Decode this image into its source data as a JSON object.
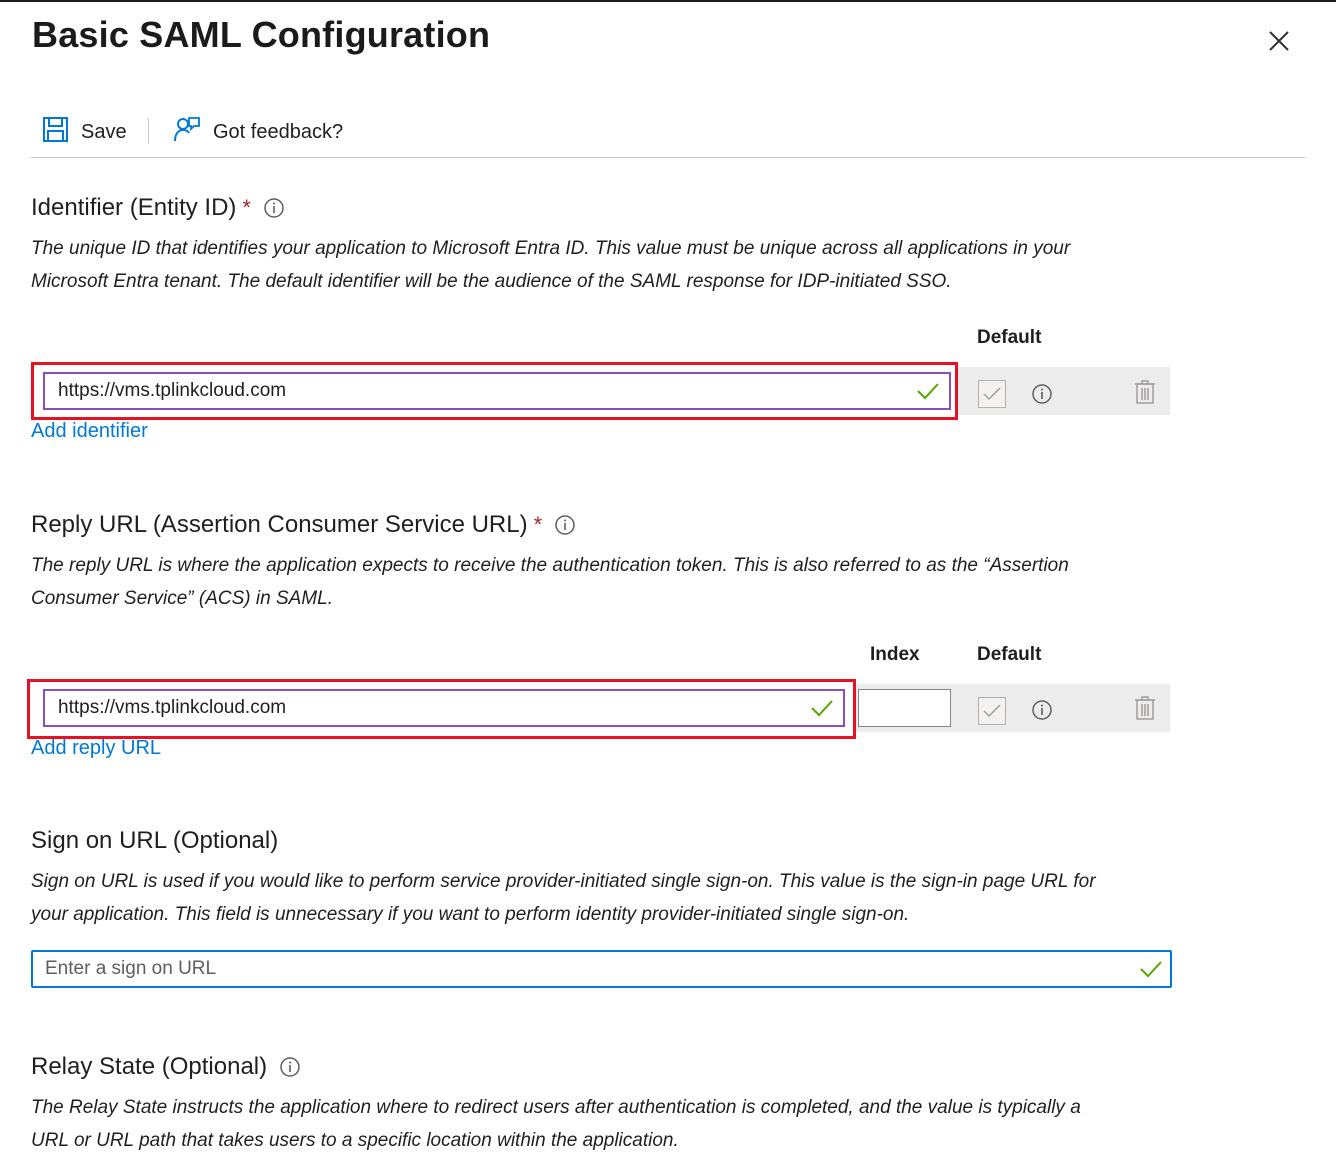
{
  "panel": {
    "title": "Basic SAML Configuration"
  },
  "toolbar": {
    "save_label": "Save",
    "feedback_label": "Got feedback?"
  },
  "identifier": {
    "title": "Identifier (Entity ID)",
    "required_mark": "*",
    "description_line1": "The unique ID that identifies your application to Microsoft Entra ID. This value must be unique across all applications in your",
    "description_line2": "Microsoft Entra tenant. The default identifier will be the audience of the SAML response for IDP-initiated SSO.",
    "default_header": "Default",
    "value": "https://vms.tplinkcloud.com",
    "add_link": "Add identifier"
  },
  "reply_url": {
    "title": "Reply URL (Assertion Consumer Service URL)",
    "required_mark": "*",
    "description_line1": "The reply URL is where the application expects to receive the authentication token. This is also referred to as the “Assertion",
    "description_line2": "Consumer Service” (ACS) in SAML.",
    "index_header": "Index",
    "default_header": "Default",
    "value": "https://vms.tplinkcloud.com",
    "index_value": "",
    "add_link": "Add reply URL"
  },
  "sign_on": {
    "title": "Sign on URL (Optional)",
    "description_line1": "Sign on URL is used if you would like to perform service provider-initiated single sign-on. This value is the sign-in page URL for",
    "description_line2": "your application. This field is unnecessary if you want to perform identity provider-initiated single sign-on.",
    "value": "",
    "placeholder": "Enter a sign on URL"
  },
  "relay_state": {
    "title": "Relay State (Optional)",
    "description_line1": "The Relay State instructs the application where to redirect users after authentication is completed, and the value is typically a",
    "description_line2": "URL or URL path that takes users to a specific location within the application."
  },
  "colors": {
    "accent": "#0078d4",
    "required": "#a4262c",
    "highlight_frame": "#e81123",
    "valid_check": "#57a300",
    "focus_border": "#8a4fbf"
  }
}
